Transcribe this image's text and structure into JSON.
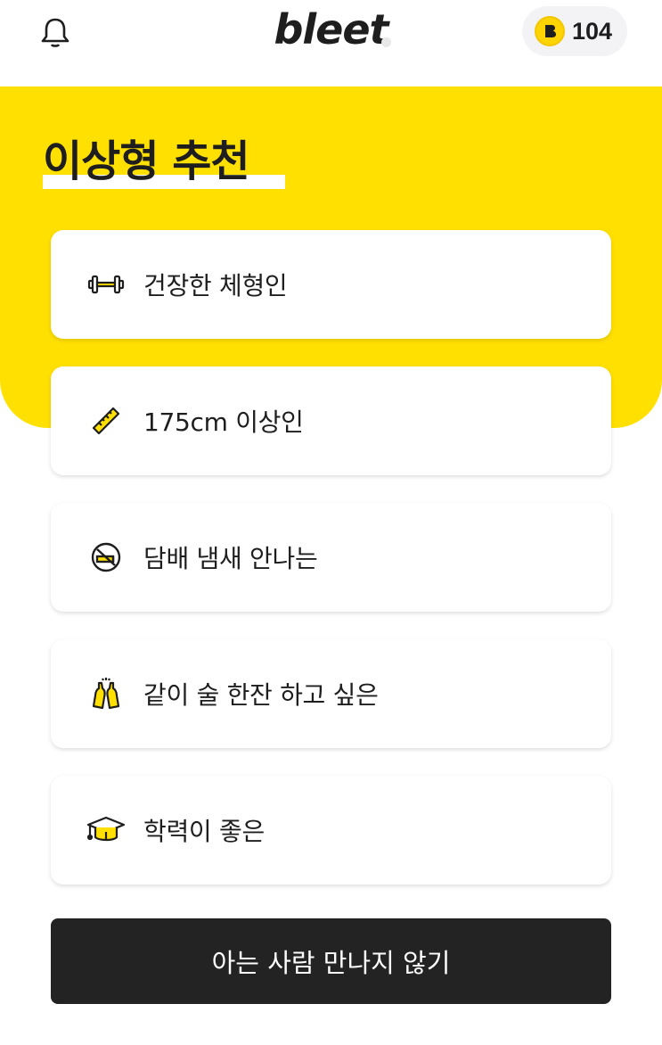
{
  "header": {
    "logo_text": "bleet",
    "coin_count": "104",
    "notification_icon": "bell-icon",
    "coin_icon": "coin-b-icon"
  },
  "colors": {
    "brand_yellow": "#ffe000",
    "dark": "#232323",
    "card_bg": "#ffffff"
  },
  "section": {
    "title": "이상형 추천"
  },
  "options": [
    {
      "label": "건장한 체형인",
      "icon": "dumbbell-icon"
    },
    {
      "label": "175cm 이상인",
      "icon": "ruler-icon"
    },
    {
      "label": "담배 냄새 안나는",
      "icon": "no-smoking-icon"
    },
    {
      "label": "같이 술 한잔 하고 싶은",
      "icon": "beer-bottles-icon"
    },
    {
      "label": "학력이 좋은",
      "icon": "graduation-cap-icon"
    }
  ],
  "cta": {
    "label": "아는 사람 만나지 않기"
  }
}
